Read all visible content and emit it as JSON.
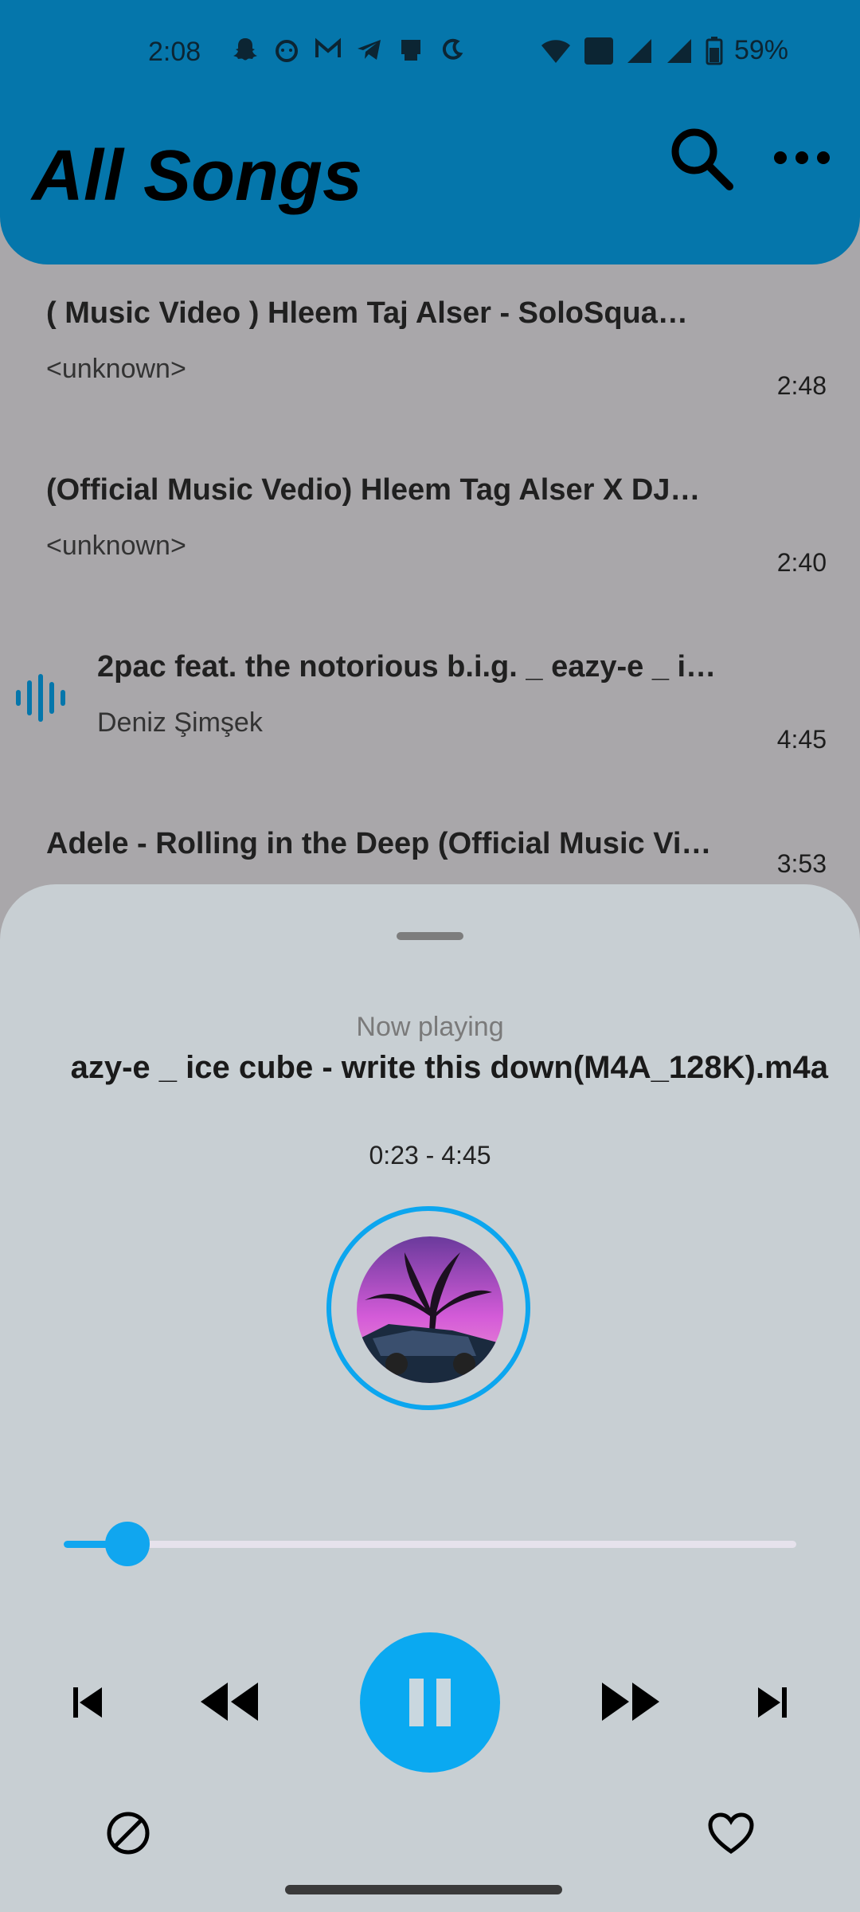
{
  "status_bar": {
    "time": "2:08",
    "battery": "59%",
    "icons": [
      "snapchat-icon",
      "reddit-icon",
      "gmail-icon",
      "telegram-icon",
      "cast-icon",
      "moon-icon",
      "wifi-icon",
      "volte-icon",
      "signal-icon",
      "signal-icon",
      "battery-icon"
    ]
  },
  "header": {
    "title": "All Songs",
    "search_icon": "search-icon",
    "more_icon": "more-horizontal-icon"
  },
  "songs": [
    {
      "title": "( Music Video )  Hleem Taj Alser - SoloSqua…",
      "artist": "<unknown>",
      "duration": "2:48"
    },
    {
      "title": "(Official Music Vedio) Hleem Tag Alser X DJ…",
      "artist": "<unknown>",
      "duration": "2:40"
    },
    {
      "title": "2pac feat. the notorious b.i.g. _ eazy-e _ i…",
      "artist": "Deniz Şimşek",
      "duration": "4:45",
      "playing": true
    },
    {
      "title": "Adele - Rolling in the Deep (Official Music Vi…",
      "artist": "",
      "duration": "3:53"
    }
  ],
  "player": {
    "now_playing_label": "Now playing",
    "track_title": "azy-e _ ice cube - write this down(M4A_128K).m4a",
    "time_range": "0:23 - 4:45",
    "progress_fraction": 0.087,
    "controls": [
      "skip-previous-icon",
      "rewind-icon",
      "pause-icon",
      "fast-forward-icon",
      "skip-next-icon"
    ],
    "bottom_left_icon": "block-icon",
    "bottom_right_icon": "heart-outline-icon"
  },
  "colors": {
    "appbar": "#0576ab",
    "accent": "#0aa9f1",
    "sheet": "#c8cfd3",
    "list_bg": "#a9a7aa"
  }
}
